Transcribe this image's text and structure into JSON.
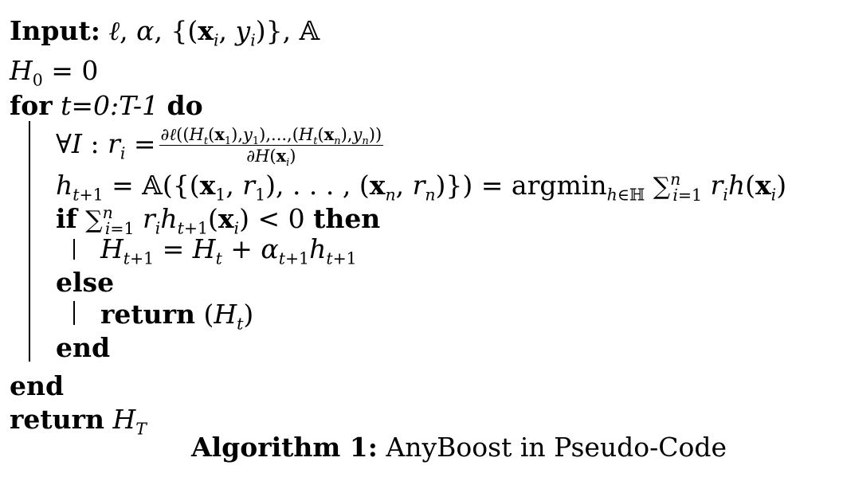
{
  "input_keyword": "Input:",
  "for_keyword": "for",
  "do_keyword": "do",
  "if_keyword": "if",
  "then_keyword": "then",
  "else_keyword": "else",
  "end_keyword": "end",
  "return_keyword": "return",
  "loop_range": "t=0:T-1",
  "caption": {
    "label": "Algorithm 1:",
    "text": " AnyBoost in Pseudo-Code"
  }
}
